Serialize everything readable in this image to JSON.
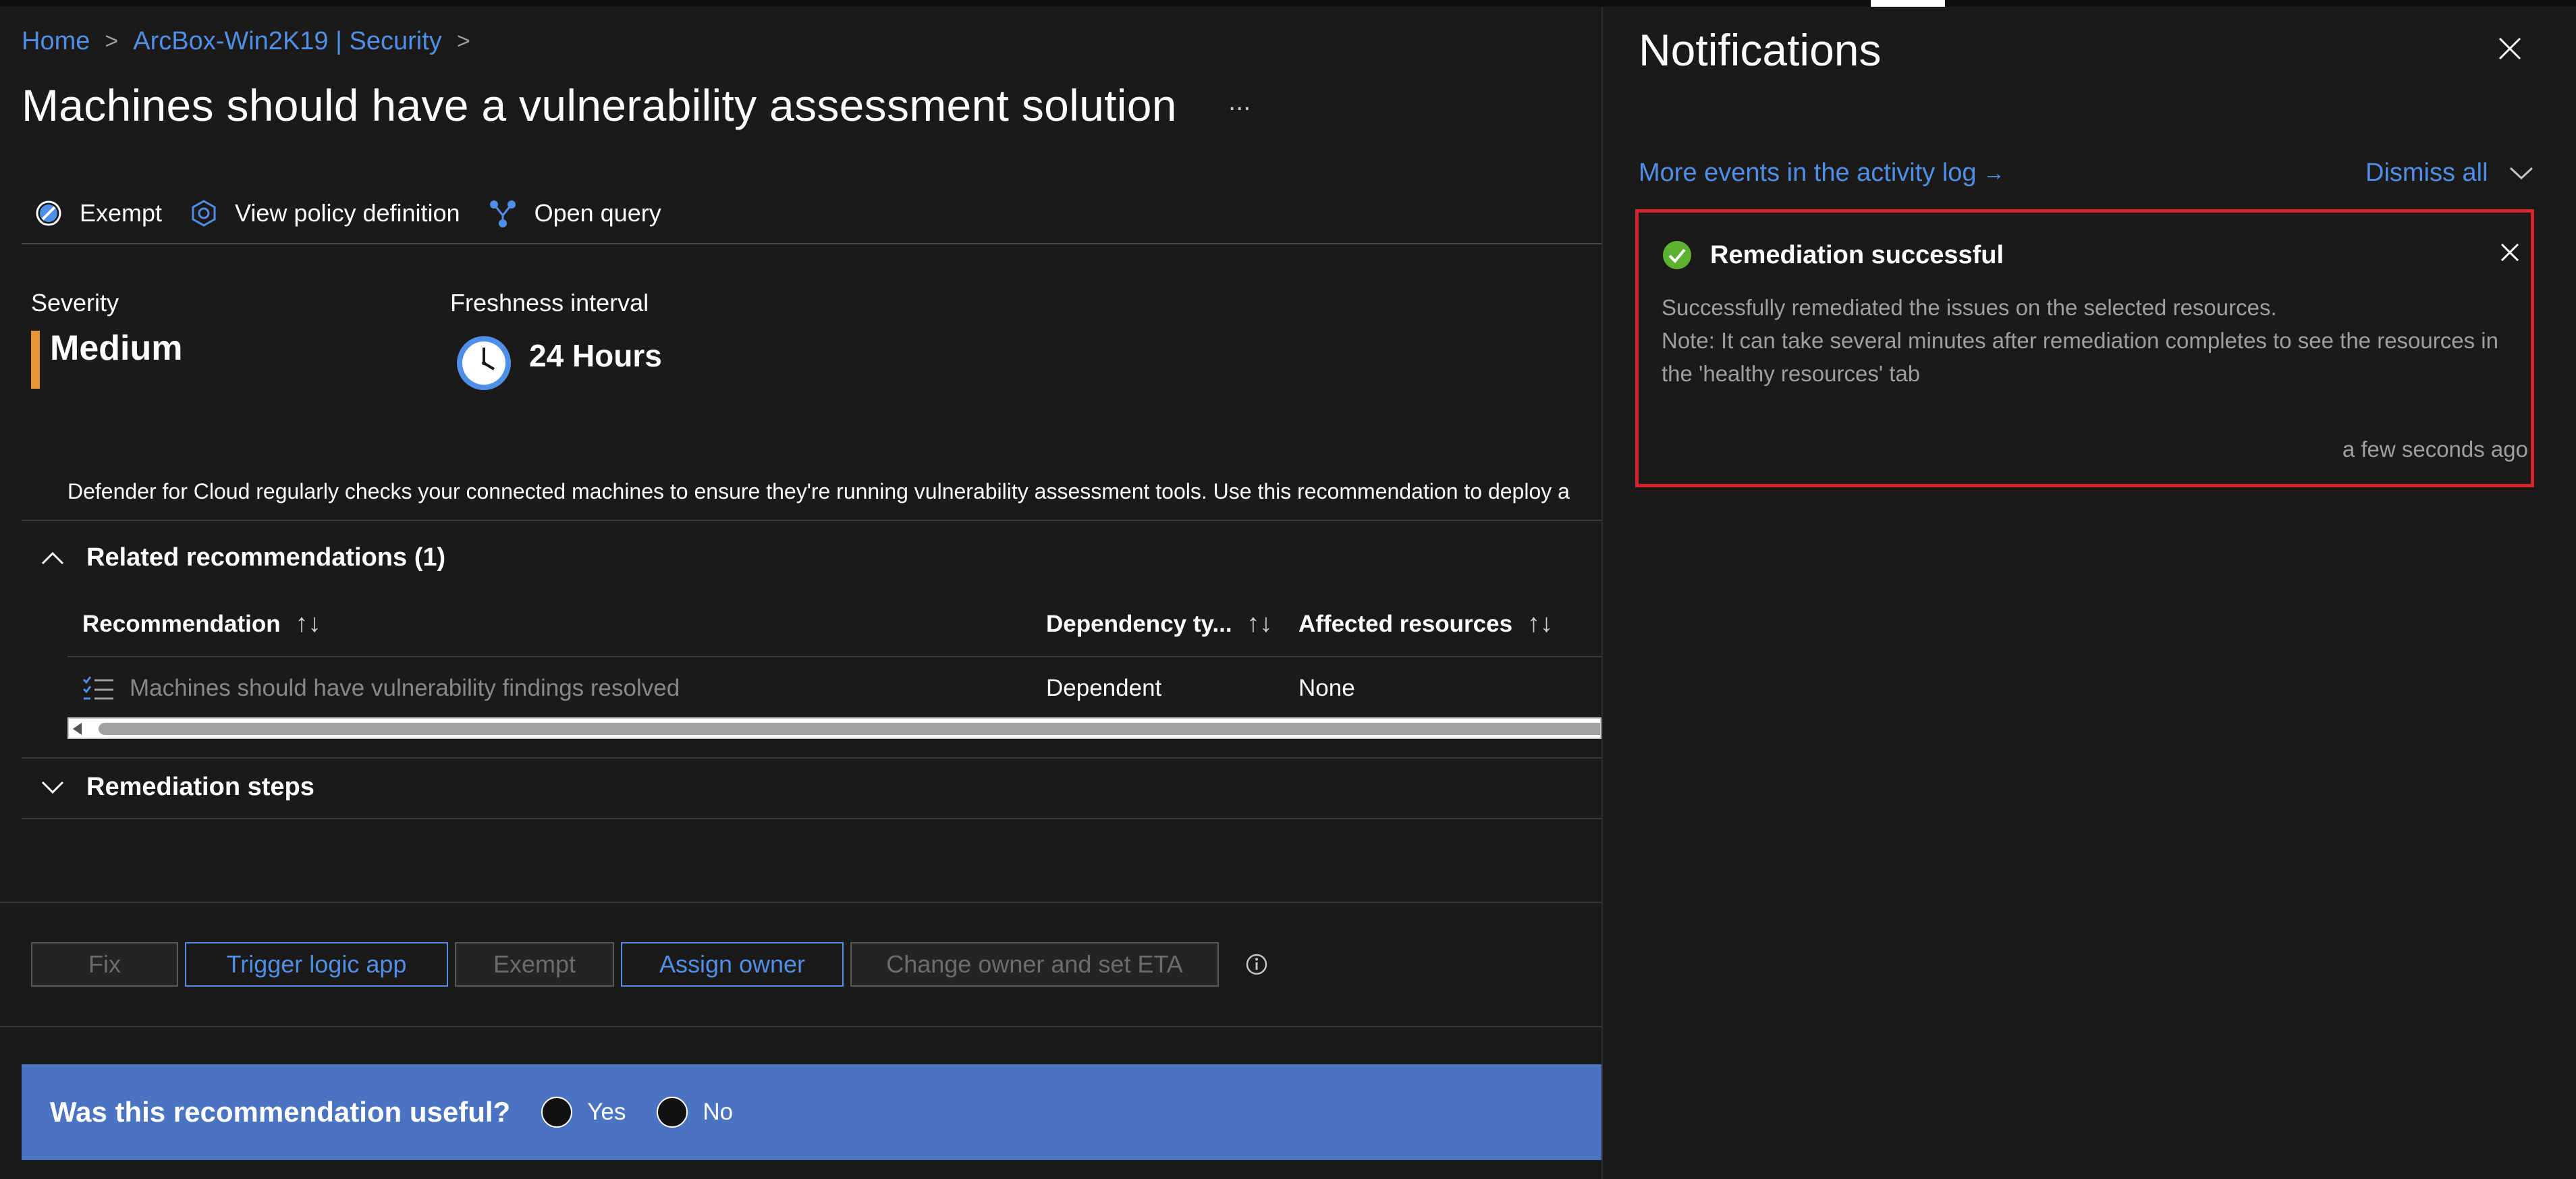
{
  "breadcrumb": {
    "home": "Home",
    "resource": "ArcBox-Win2K19 | Security"
  },
  "page": {
    "title": "Machines should have a vulnerability assessment solution",
    "more": "..."
  },
  "toolbar": {
    "exempt": "Exempt",
    "view_policy": "View policy definition",
    "open_query": "Open query"
  },
  "details": {
    "severity_label": "Severity",
    "severity_value": "Medium",
    "severity_color": "#e8953a",
    "freshness_label": "Freshness interval",
    "freshness_value": "24 Hours"
  },
  "description": "Defender for Cloud regularly checks your connected machines to ensure they're running vulnerability assessment tools. Use this recommendation to deploy a",
  "related": {
    "header": "Related recommendations (1)",
    "columns": [
      "Recommendation",
      "Dependency ty...",
      "Affected resources"
    ],
    "rows": [
      {
        "recommendation": "Machines should have vulnerability findings resolved",
        "dependency": "Dependent",
        "affected": "None"
      }
    ]
  },
  "remediation": {
    "header": "Remediation steps"
  },
  "actions": {
    "fix": "Fix",
    "trigger": "Trigger logic app",
    "exempt": "Exempt",
    "assign": "Assign owner",
    "change": "Change owner and set ETA"
  },
  "feedback": {
    "question": "Was this recommendation useful?",
    "yes": "Yes",
    "no": "No",
    "bg_color": "#4a74c2"
  },
  "notifications": {
    "title": "Notifications",
    "more_events": "More events in the activity log",
    "more_events_arrow": "→",
    "dismiss_all": "Dismiss all",
    "toast": {
      "title": "Remediation successful",
      "line1": "Successfully remediated the issues on the selected resources.",
      "line2": "Note: It can take several minutes after remediation completes to see the resources in the 'healthy resources' tab",
      "time": "a few seconds ago",
      "highlight_color": "#d3232f",
      "success_color": "#5db130"
    }
  },
  "colors": {
    "accent": "#4f8fe8",
    "background": "#1b1a19"
  }
}
